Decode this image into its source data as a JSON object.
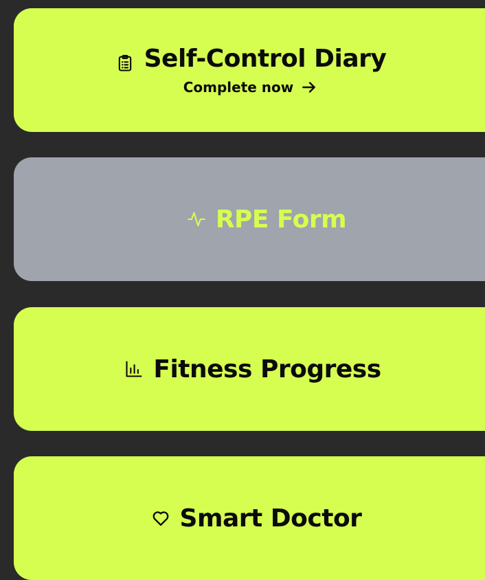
{
  "colors": {
    "background": "#2a2a2a",
    "accent": "#d6fe51",
    "disabled_card": "#9fa4ad",
    "text": "#0b0b0b"
  },
  "cards": [
    {
      "title": "Self-Control Diary",
      "icon": "clipboard-list-icon",
      "subtitle": "Complete now",
      "subtitle_icon": "arrow-right-icon",
      "state": "active"
    },
    {
      "title": "RPE Form",
      "icon": "activity-pulse-icon",
      "state": "disabled"
    },
    {
      "title": "Fitness Progress",
      "icon": "bar-chart-icon",
      "state": "active"
    },
    {
      "title": "Smart Doctor",
      "icon": "heart-icon",
      "state": "active"
    }
  ]
}
